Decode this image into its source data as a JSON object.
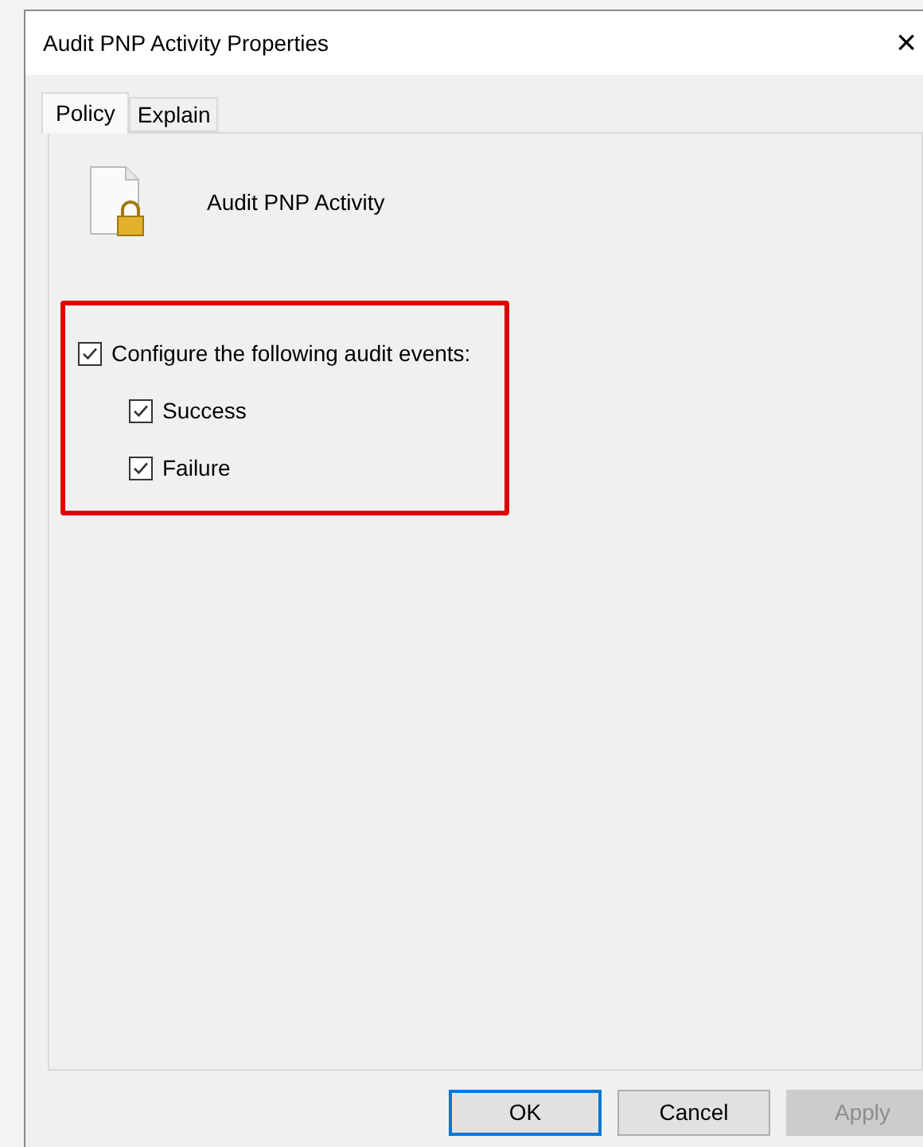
{
  "window": {
    "title": "Audit PNP Activity Properties",
    "close": "×"
  },
  "tabs": [
    {
      "label": "Policy",
      "selected": true
    },
    {
      "label": "Explain",
      "selected": false
    }
  ],
  "policy": {
    "name": "Audit PNP Activity"
  },
  "options": [
    {
      "label": "Configure the following audit events:",
      "checked": true,
      "children": [
        {
          "label": "Success",
          "checked": true
        },
        {
          "label": "Failure",
          "checked": true
        }
      ]
    }
  ],
  "buttons": [
    {
      "label": "OK",
      "default": true,
      "disabled": false
    },
    {
      "label": "Cancel",
      "default": false,
      "disabled": false
    },
    {
      "label": "Apply",
      "default": false,
      "disabled": true
    }
  ]
}
